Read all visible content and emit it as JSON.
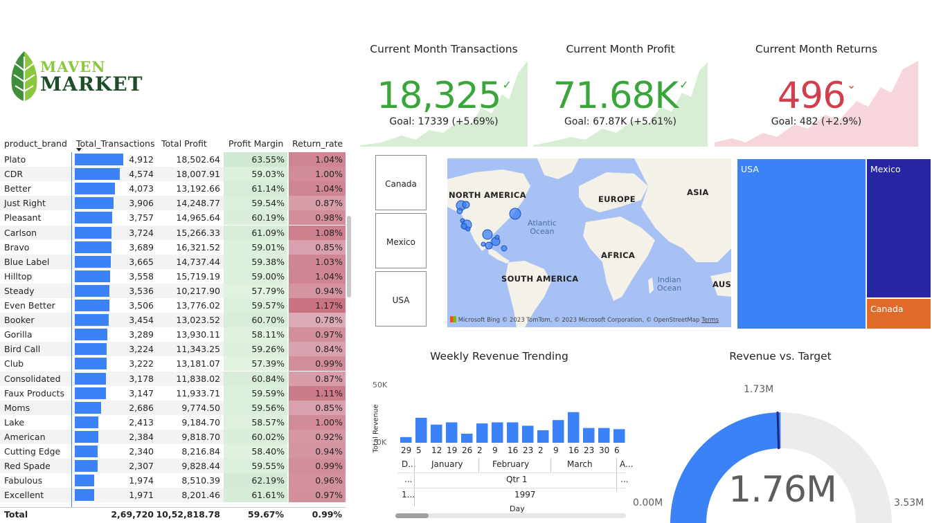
{
  "brand": {
    "line1": "MAVEN",
    "line2": "MARKET"
  },
  "colors": {
    "accent_blue": "#3b82f6",
    "kpi_good": "#3aa53a",
    "kpi_bad": "#d13f4e",
    "treemap_usa": "#3b82f6",
    "treemap_mexico": "#2626a3",
    "treemap_canada": "#e06b2b"
  },
  "table": {
    "headers": {
      "brand": "product_brand",
      "tx": "Total_Transactions",
      "profit": "Total Profit",
      "margin": "Profit Margin",
      "ret": "Return_rate"
    },
    "rows": [
      {
        "brand": "Plato",
        "tx": "4,912",
        "tx_n": 4912,
        "profit": "18,502.64",
        "margin": "63.55%",
        "ret": "1.04%"
      },
      {
        "brand": "CDR",
        "tx": "4,574",
        "tx_n": 4574,
        "profit": "18,007.91",
        "margin": "59.03%",
        "ret": "1.00%"
      },
      {
        "brand": "Better",
        "tx": "4,073",
        "tx_n": 4073,
        "profit": "13,192.66",
        "margin": "61.14%",
        "ret": "1.04%"
      },
      {
        "brand": "Just Right",
        "tx": "3,906",
        "tx_n": 3906,
        "profit": "14,248.77",
        "margin": "59.54%",
        "ret": "0.87%"
      },
      {
        "brand": "Pleasant",
        "tx": "3,757",
        "tx_n": 3757,
        "profit": "14,965.64",
        "margin": "60.19%",
        "ret": "0.98%"
      },
      {
        "brand": "Carlson",
        "tx": "3,724",
        "tx_n": 3724,
        "profit": "15,266.33",
        "margin": "61.09%",
        "ret": "1.08%"
      },
      {
        "brand": "Bravo",
        "tx": "3,689",
        "tx_n": 3689,
        "profit": "16,321.52",
        "margin": "59.01%",
        "ret": "0.85%"
      },
      {
        "brand": "Blue Label",
        "tx": "3,665",
        "tx_n": 3665,
        "profit": "14,737.44",
        "margin": "59.38%",
        "ret": "1.03%"
      },
      {
        "brand": "Hilltop",
        "tx": "3,558",
        "tx_n": 3558,
        "profit": "15,719.19",
        "margin": "59.00%",
        "ret": "1.04%"
      },
      {
        "brand": "Steady",
        "tx": "3,536",
        "tx_n": 3536,
        "profit": "10,217.90",
        "margin": "57.79%",
        "ret": "0.94%"
      },
      {
        "brand": "Even Better",
        "tx": "3,506",
        "tx_n": 3506,
        "profit": "13,776.02",
        "margin": "59.57%",
        "ret": "1.17%"
      },
      {
        "brand": "Booker",
        "tx": "3,454",
        "tx_n": 3454,
        "profit": "13,023.52",
        "margin": "60.70%",
        "ret": "0.78%"
      },
      {
        "brand": "Gorilla",
        "tx": "3,289",
        "tx_n": 3289,
        "profit": "13,930.11",
        "margin": "58.11%",
        "ret": "0.97%"
      },
      {
        "brand": "Bird Call",
        "tx": "3,224",
        "tx_n": 3224,
        "profit": "11,343.25",
        "margin": "59.26%",
        "ret": "0.84%"
      },
      {
        "brand": "Club",
        "tx": "3,222",
        "tx_n": 3222,
        "profit": "13,181.07",
        "margin": "57.39%",
        "ret": "0.99%"
      },
      {
        "brand": "Consolidated",
        "tx": "3,178",
        "tx_n": 3178,
        "profit": "11,838.02",
        "margin": "60.84%",
        "ret": "0.87%"
      },
      {
        "brand": "Faux Products",
        "tx": "3,147",
        "tx_n": 3147,
        "profit": "11,933.71",
        "margin": "59.59%",
        "ret": "1.11%"
      },
      {
        "brand": "Moms",
        "tx": "2,686",
        "tx_n": 2686,
        "profit": "9,774.50",
        "margin": "59.56%",
        "ret": "0.85%"
      },
      {
        "brand": "Lake",
        "tx": "2,413",
        "tx_n": 2413,
        "profit": "9,184.70",
        "margin": "58.57%",
        "ret": "1.00%"
      },
      {
        "brand": "American",
        "tx": "2,384",
        "tx_n": 2384,
        "profit": "9,818.70",
        "margin": "60.02%",
        "ret": "0.92%"
      },
      {
        "brand": "Cutting Edge",
        "tx": "2,340",
        "tx_n": 2340,
        "profit": "8,216.84",
        "margin": "58.40%",
        "ret": "0.94%"
      },
      {
        "brand": "Red Spade",
        "tx": "2,307",
        "tx_n": 2307,
        "profit": "9,828.44",
        "margin": "59.55%",
        "ret": "0.99%"
      },
      {
        "brand": "Fabulous",
        "tx": "1,974",
        "tx_n": 1974,
        "profit": "8,510.39",
        "margin": "62.19%",
        "ret": "0.96%"
      },
      {
        "brand": "Excellent",
        "tx": "1,971",
        "tx_n": 1971,
        "profit": "8,201.46",
        "margin": "61.61%",
        "ret": "0.97%"
      }
    ],
    "total": {
      "label": "Total",
      "tx": "2,69,720",
      "profit": "10,52,818.78",
      "margin": "59.67%",
      "ret": "0.99%"
    }
  },
  "kpis": {
    "transactions": {
      "title": "Current Month Transactions",
      "value": "18,325",
      "goal": "Goal: 17339 (+5.69%)",
      "status": "good"
    },
    "profit": {
      "title": "Current Month Profit",
      "value": "71.68K",
      "goal": "Goal: 67.87K (+5.61%)",
      "status": "good"
    },
    "returns": {
      "title": "Current Month Returns",
      "value": "496",
      "goal": "Goal: 482 (+2.9%)",
      "status": "bad"
    }
  },
  "slicer": {
    "items": [
      "Canada",
      "Mexico",
      "USA"
    ]
  },
  "map": {
    "labels": {
      "north_america": "NORTH AMERICA",
      "europe": "EUROPE",
      "asia": "ASIA",
      "africa": "AFRICA",
      "south_america": "SOUTH AMERICA",
      "aust": "AUST",
      "atlantic_1": "Atlantic",
      "atlantic_2": "Ocean",
      "indian_1": "Indian",
      "indian_2": "Ocean"
    },
    "attribution_logo": "Microsoft Bing",
    "attribution": "© 2023 TomTom, © 2023 Microsoft Corporation, © OpenStreetMap",
    "terms": "Terms"
  },
  "treemap": {
    "items": [
      {
        "label": "USA"
      },
      {
        "label": "Mexico"
      },
      {
        "label": "Canada"
      }
    ]
  },
  "weekly": {
    "title": "Weekly Revenue Trending",
    "ylabel": "Total Revenue",
    "xlabel": "Day",
    "yticks": [
      "50K",
      "0K"
    ],
    "day_ticks": [
      "29",
      "5",
      "12",
      "19",
      "26",
      "2",
      "9",
      "16",
      "23",
      "2",
      "9",
      "16",
      "23",
      "30",
      "6"
    ],
    "months": [
      "D...",
      "January",
      "February",
      "March",
      "A..."
    ],
    "quarter_row": [
      "...",
      "Qtr 1",
      "..."
    ],
    "year_row": [
      "1...",
      "1997"
    ]
  },
  "gauge": {
    "title": "Revenue vs. Target",
    "value_label": "1.76M",
    "min_label": "0.00M",
    "max_label": "3.53M",
    "target_label": "1.73M",
    "value": 1.76,
    "min": 0,
    "max": 3.53,
    "target": 1.73
  },
  "chart_data": {
    "type": "bar",
    "title": "Weekly Revenue Trending",
    "xlabel": "Day",
    "ylabel": "Total Revenue",
    "categories": [
      "29",
      "5",
      "12",
      "19",
      "26",
      "2",
      "9",
      "16",
      "23",
      "2",
      "9",
      "16",
      "23",
      "30",
      "6"
    ],
    "values": [
      5000,
      22000,
      16000,
      18000,
      8000,
      17000,
      18000,
      18000,
      15000,
      11000,
      20000,
      27000,
      13000,
      13000,
      12000
    ],
    "ylim": [
      0,
      50000
    ],
    "grid": false
  }
}
